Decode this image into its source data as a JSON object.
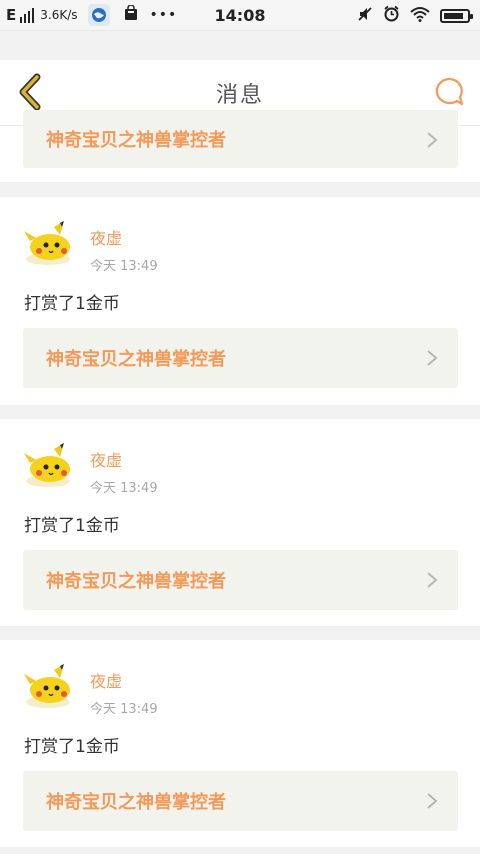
{
  "status_bar": {
    "network": "E",
    "speed": "3.6K/s",
    "dots": "•••",
    "time": "14:08",
    "battery_level": 0.85
  },
  "header": {
    "title": "消息",
    "accent_color": "#f39a5a",
    "back_color": "#d9b435"
  },
  "top_link": {
    "label": "神奇宝贝之神兽掌控者"
  },
  "messages": [
    {
      "user": "夜虚",
      "time": "今天 13:49",
      "text": "打赏了1金币",
      "link": "神奇宝贝之神兽掌控者"
    },
    {
      "user": "夜虚",
      "time": "今天 13:49",
      "text": "打赏了1金币",
      "link": "神奇宝贝之神兽掌控者"
    },
    {
      "user": "夜虚",
      "time": "今天 13:49",
      "text": "打赏了1金币",
      "link": "神奇宝贝之神兽掌控者"
    }
  ]
}
